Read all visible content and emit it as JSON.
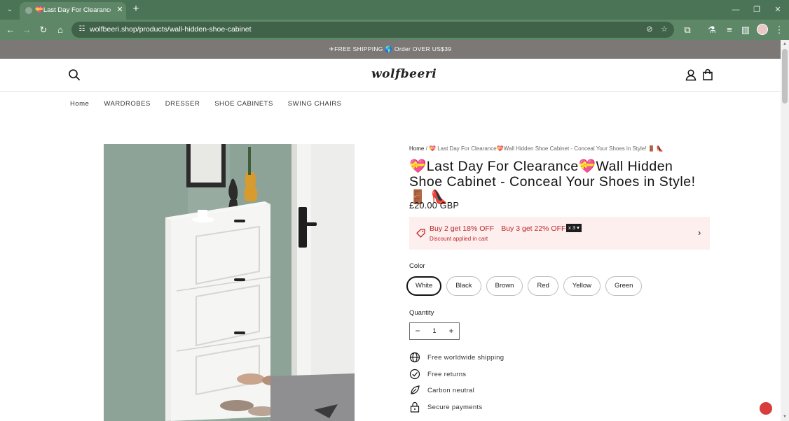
{
  "browser": {
    "tab_title": "💝Last Day For Clearance💝W",
    "url": "wolfbeeri.shop/products/wall-hidden-shoe-cabinet",
    "icons": [
      "tab-list-icon",
      "close-icon",
      "plus-icon",
      "minimize-icon",
      "restore-icon",
      "close-window-icon",
      "back-icon",
      "forward-icon",
      "reload-icon",
      "home-icon",
      "site-info-icon",
      "eye-off-icon",
      "star-icon",
      "extensions-icon",
      "flask-icon",
      "media-icon",
      "side-panel-icon",
      "profile-avatar",
      "menu-dots-icon"
    ]
  },
  "announcement": "✈FREE SHIPPING 🌎 Order OVER US$39",
  "header": {
    "logo": "wolfbeeri",
    "icons": [
      "search-icon",
      "account-icon",
      "cart-icon"
    ]
  },
  "nav": [
    "Home",
    "WARDROBES",
    "DRESSER",
    "SHOE CABINETS",
    "SWING CHAIRS"
  ],
  "product": {
    "breadcrumb_home": "Home",
    "breadcrumb_sep": " / ",
    "breadcrumb_current": "💝 Last Day For Clearance💝Wall Hidden Shoe Cabinet - Conceal Your Shoes in Style! 🚪 👠",
    "title": "💝Last Day For Clearance💝Wall Hidden Shoe Cabinet - Conceal Your Shoes in Style! 🚪 👠",
    "price": "£20.00 GBP",
    "promo": {
      "offer1": "Buy 2 get 18% OFF",
      "offer2": "Buy 3 get 22% OFF",
      "badge": "x 3 ▾",
      "note": "Discount applied in cart",
      "color": "#c0262a",
      "background": "#fcefee"
    },
    "color_label": "Color",
    "colors": [
      "White",
      "Black",
      "Brown",
      "Red",
      "Yellow",
      "Green"
    ],
    "selected_color": "White",
    "quantity_label": "Quantity",
    "quantity": "1",
    "minus": "−",
    "plus": "+",
    "features": [
      "Free worldwide shipping",
      "Free returns",
      "Carbon neutral",
      "Secure payments"
    ]
  },
  "colors": {
    "tabbar": "#4b7356",
    "toolbar": "#5e8767",
    "announcement": "#7b7876"
  }
}
